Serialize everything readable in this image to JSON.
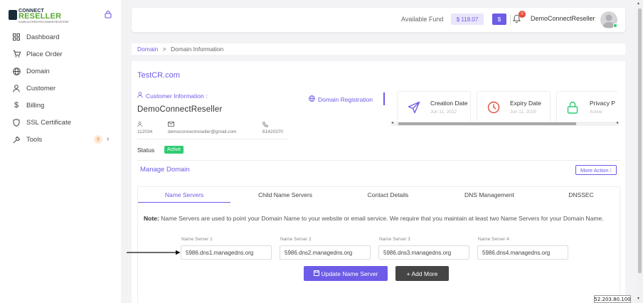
{
  "brand": {
    "line1": "CONNECT",
    "line2": "RESELLER",
    "tagline": "ICANN ACCREDITED DOMAIN REGISTRAR"
  },
  "sidebar": {
    "items": [
      {
        "label": "Dashboard",
        "icon": "grid-icon"
      },
      {
        "label": "Place Order",
        "icon": "cart-icon"
      },
      {
        "label": "Domain",
        "icon": "globe-icon"
      },
      {
        "label": "Customer",
        "icon": "user-icon"
      },
      {
        "label": "Billing",
        "icon": "dollar-icon"
      },
      {
        "label": "SSL Certificate",
        "icon": "shield-icon"
      },
      {
        "label": "Tools",
        "icon": "wrench-icon",
        "badge": "9"
      }
    ]
  },
  "header": {
    "fund_label": "Available Fund",
    "fund_value": "$ 118.07",
    "dollar_button": "$",
    "notification_count": "0",
    "username": "DemoConnectReseller"
  },
  "breadcrumb": {
    "root": "Domain",
    "separator": ">",
    "current": "Domain Information"
  },
  "domain": {
    "name": "TestCR.com",
    "customer_info_label": "Customer Information :",
    "customer_name": "DemoConnectReseller",
    "customer_id": "112034",
    "customer_email": "democonnectreseller@gmail.com",
    "customer_phone": "61420370",
    "status_label": "Status",
    "status_value": "Active",
    "registration_link": "Domain Registration"
  },
  "info_cards": [
    {
      "title": "Creation Date",
      "sub": "Jun 11, 2022"
    },
    {
      "title": "Expiry Date",
      "sub": "Jun 11, 2025"
    },
    {
      "title": "Privacy P",
      "sub": "Active"
    }
  ],
  "manage": {
    "title": "Manage Domain",
    "more_action": "More Action ⁝"
  },
  "tabs": [
    "Name Servers",
    "Child Name Servers",
    "Contact Details",
    "DNS Management",
    "DNSSEC"
  ],
  "note": {
    "label": "Note:",
    "text": " Name Servers are used to point your Domain Name to your website or email service. We require that you maintain at least two Name Servers for your Domain Name."
  },
  "name_servers": [
    {
      "label": "Name Server 1",
      "value": "5986.dns1.managedns.org"
    },
    {
      "label": "Name Server 2",
      "value": "5986.dns2.managedns.org"
    },
    {
      "label": "Name Server 3",
      "value": "5986.dns3.managedns.org"
    },
    {
      "label": "Name Server 4",
      "value": "5986.dns4.managedns.org"
    }
  ],
  "buttons": {
    "update": "Update Name Server",
    "add_more": "+ Add More"
  },
  "ip_tooltip": "52.203.80.100",
  "colors": {
    "accent": "#6c5ce7",
    "brand_green": "#5aa832",
    "success": "#2ecc71",
    "danger": "#e74c3c"
  }
}
